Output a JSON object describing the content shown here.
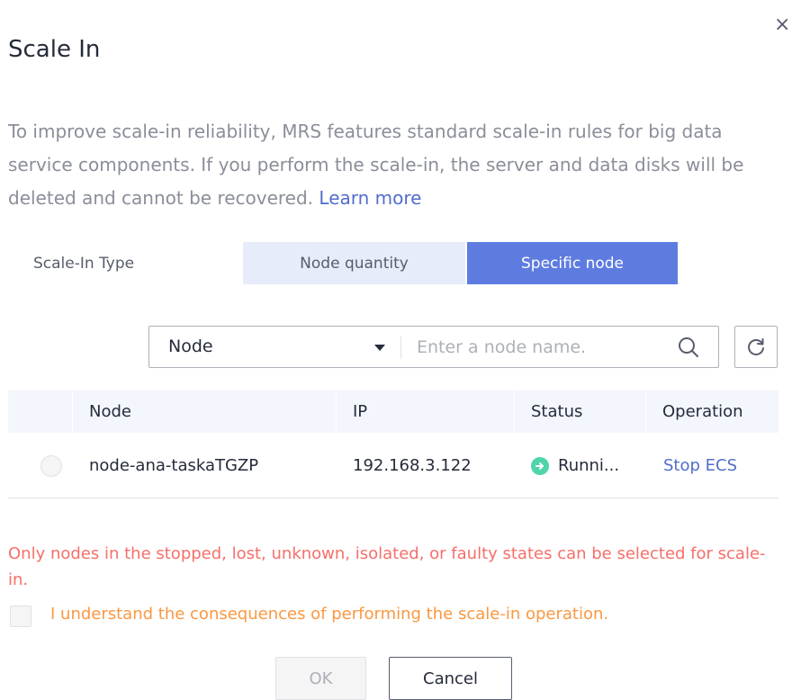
{
  "dialog": {
    "title": "Scale In",
    "close_glyph": "×",
    "description": "To improve scale-in reliability, MRS features standard scale-in rules for big data service components. If you perform the scale-in, the server and data disks will be deleted and cannot be recovered.",
    "learn_more": "Learn more"
  },
  "scale_in_type": {
    "label": "Scale-In Type",
    "options": [
      "Node quantity",
      "Specific node"
    ],
    "selected": "Specific node"
  },
  "search": {
    "filter_value": "Node",
    "placeholder": "Enter a node name.",
    "value": ""
  },
  "table": {
    "columns": [
      "Node",
      "IP",
      "Status",
      "Operation"
    ],
    "rows": [
      {
        "node": "node-ana-taskaTGZP",
        "ip": "192.168.3.122",
        "status": "Runni...",
        "operation": "Stop ECS"
      }
    ]
  },
  "warning": "Only nodes in the stopped, lost, unknown, isolated, or faulty states can be selected for scale-in.",
  "acknowledge_label": "I understand the consequences of performing the scale-in operation.",
  "buttons": {
    "ok": "OK",
    "cancel": "Cancel"
  },
  "colors": {
    "primary": "#5e7ce0",
    "link": "#526ecc",
    "warning": "#f66f6a",
    "notice": "#fa9841",
    "status_running": "#50d4ab"
  },
  "icons": {
    "close": "close-icon",
    "dropdown": "chevron-down-icon",
    "search": "search-icon",
    "refresh": "refresh-icon",
    "status": "arrow-right-circle-icon"
  }
}
